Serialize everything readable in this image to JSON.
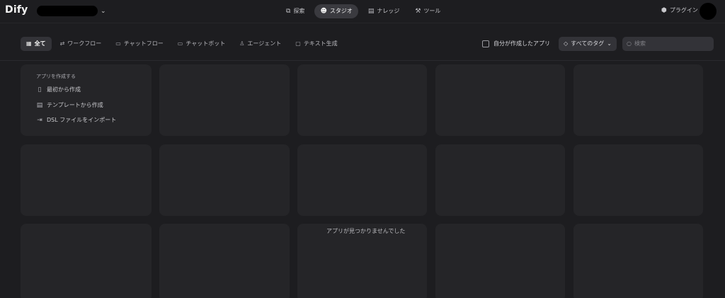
{
  "header": {
    "logo": "Dify",
    "workspace_chevron": "⌄",
    "nav": [
      {
        "label": "探索",
        "icon": "explore-icon",
        "glyph": "⧉",
        "active": false
      },
      {
        "label": "スタジオ",
        "icon": "studio-icon",
        "glyph": "☻",
        "active": true
      },
      {
        "label": "ナレッジ",
        "icon": "knowledge-icon",
        "glyph": "▤",
        "active": false
      },
      {
        "label": "ツール",
        "icon": "tools-icon",
        "glyph": "⚒",
        "active": false
      }
    ],
    "plugin_label": "プラグイン",
    "plugin_glyph": "⬢"
  },
  "filters": {
    "tabs": [
      {
        "label": "全て",
        "icon": "grid-icon",
        "glyph": "▦",
        "active": true
      },
      {
        "label": "ワークフロー",
        "icon": "workflow-icon",
        "glyph": "⇄",
        "active": false
      },
      {
        "label": "チャットフロー",
        "icon": "chatflow-icon",
        "glyph": "▭",
        "active": false
      },
      {
        "label": "チャットボット",
        "icon": "chatbot-icon",
        "glyph": "▭",
        "active": false
      },
      {
        "label": "エージェント",
        "icon": "agent-icon",
        "glyph": "♙",
        "active": false
      },
      {
        "label": "テキスト生成",
        "icon": "text-generation-icon",
        "glyph": "▢",
        "active": false
      }
    ],
    "mine_label": "自分が作成したアプリ",
    "tags_label": "すべてのタグ",
    "tags_glyph": "◇",
    "tags_chevron": "⌄",
    "search_placeholder": "検索",
    "search_glyph": "○"
  },
  "create": {
    "title": "アプリを作成する",
    "items": [
      {
        "label": "最初から作成",
        "icon": "blank-file-icon",
        "glyph": "▯"
      },
      {
        "label": "テンプレートから作成",
        "icon": "template-icon",
        "glyph": "▤"
      },
      {
        "label": "DSL ファイルをインポート",
        "icon": "import-icon",
        "glyph": "⇥"
      }
    ]
  },
  "empty_message": "アプリが見つかりませんでした"
}
